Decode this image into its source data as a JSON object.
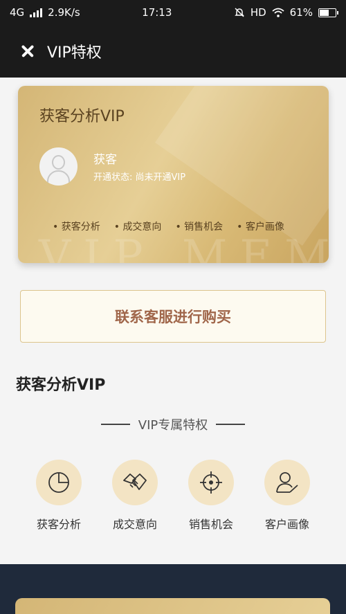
{
  "status_bar": {
    "network": "4G",
    "speed": "2.9K/s",
    "time": "17:13",
    "hd": "HD",
    "battery_pct": "61%",
    "battery_level": 0.61
  },
  "nav": {
    "title": "VIP特权"
  },
  "vip_card": {
    "title": "获客分析VIP",
    "user_name": "获客",
    "status": "开通状态: 尚未开通VIP",
    "features": [
      "获客分析",
      "成交意向",
      "销售机会",
      "客户画像"
    ],
    "watermark": "VIP MEMB"
  },
  "contact_button": {
    "label": "联系客服进行购买"
  },
  "section": {
    "title": "获客分析VIP",
    "subtitle": "VIP专属特权"
  },
  "privileges": [
    {
      "label": "获客分析",
      "icon": "pie-chart-icon"
    },
    {
      "label": "成交意向",
      "icon": "handshake-icon"
    },
    {
      "label": "销售机会",
      "icon": "target-icon"
    },
    {
      "label": "客户画像",
      "icon": "user-profile-icon"
    }
  ],
  "colors": {
    "gold_accent": "#d4b676",
    "button_text": "#a0664a",
    "dark_bar": "#1b1b1b",
    "footer_navy": "#1f2a3b"
  }
}
